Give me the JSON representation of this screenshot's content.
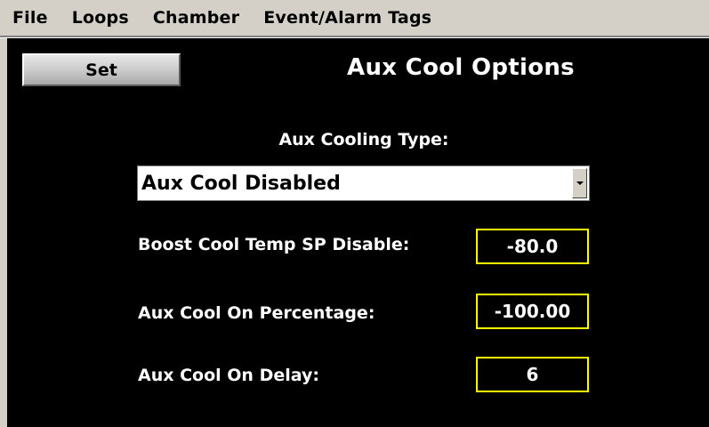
{
  "menubar": {
    "items": [
      {
        "label": "File"
      },
      {
        "label": "Loops"
      },
      {
        "label": "Chamber"
      },
      {
        "label": "Event/Alarm Tags"
      }
    ]
  },
  "toolbar": {
    "set_label": "Set"
  },
  "page": {
    "title": "Aux Cool Options"
  },
  "cooling_type": {
    "label": "Aux Cooling Type:",
    "selected": "Aux Cool Disabled"
  },
  "fields": [
    {
      "label": "Boost Cool Temp SP Disable:",
      "value": "-80.0"
    },
    {
      "label": "Aux Cool On Percentage:",
      "value": "-100.00"
    },
    {
      "label": "Aux Cool On Delay:",
      "value": "6"
    }
  ],
  "colors": {
    "panel_background": "#000000",
    "menu_background": "#d4d0c8",
    "field_border": "#ffff00",
    "text": "#ffffff"
  }
}
